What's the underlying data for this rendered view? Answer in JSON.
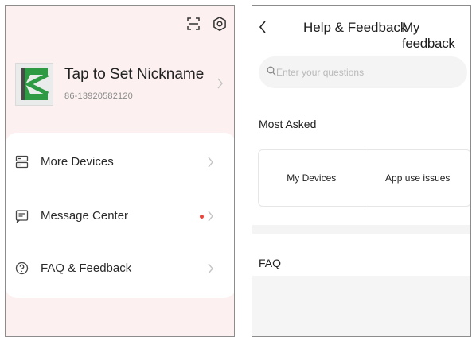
{
  "profile_screen": {
    "top_icons": [
      "scan-icon",
      "settings-icon"
    ],
    "avatar_icon": "brand-logo-icon",
    "nickname": "Tap to Set Nickname",
    "phone": "86-13920582120",
    "menu": [
      {
        "label": "More Devices",
        "icon": "devices-icon"
      },
      {
        "label": "Message Center",
        "icon": "message-icon",
        "has_dot": true
      },
      {
        "label": "FAQ & Feedback",
        "icon": "question-icon"
      }
    ],
    "colors": {
      "background": "#fcf1f0",
      "card": "#ffffff",
      "dot": "#e8453c",
      "logo_green": "#2e9a44"
    }
  },
  "help_screen": {
    "title": "Help & Feedback",
    "my_feedback": "My feedback",
    "search_placeholder": "Enter your questions",
    "most_asked_label": "Most Asked",
    "most_asked_items": [
      "My Devices",
      "App use issues"
    ],
    "faq_label": "FAQ"
  }
}
